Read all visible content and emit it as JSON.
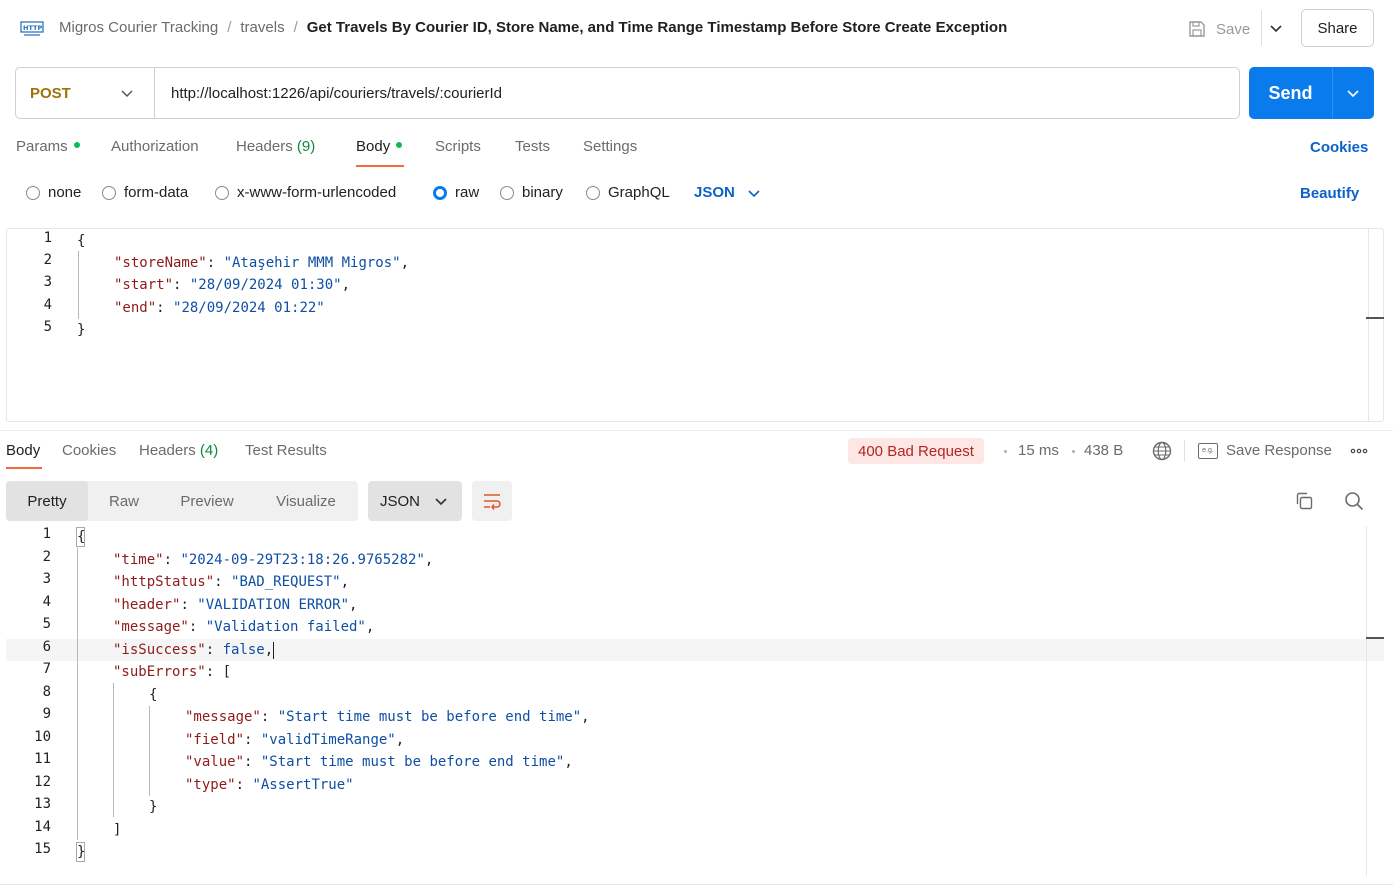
{
  "breadcrumb": {
    "collection": "Migros Courier Tracking",
    "folder": "travels",
    "request": "Get Travels By Courier ID, Store Name, and Time Range Timestamp Before Store Create Exception",
    "separator": "/"
  },
  "toolbar": {
    "save_label": "Save",
    "share_label": "Share"
  },
  "request": {
    "method": "POST",
    "url": "http://localhost:1226/api/couriers/travels/:courierId",
    "send_label": "Send"
  },
  "request_tabs": {
    "params": "Params",
    "authorization": "Authorization",
    "headers": "Headers",
    "headers_count": "(9)",
    "body": "Body",
    "scripts": "Scripts",
    "tests": "Tests",
    "settings": "Settings",
    "cookies": "Cookies"
  },
  "body_modes": {
    "none": "none",
    "form_data": "form-data",
    "urlencoded": "x-www-form-urlencoded",
    "raw": "raw",
    "binary": "binary",
    "graphql": "GraphQL",
    "selected": "raw",
    "language": "JSON",
    "beautify": "Beautify"
  },
  "request_body": {
    "line_numbers": [
      "1",
      "2",
      "3",
      "4",
      "5"
    ],
    "open_brace": "{",
    "close_brace": "}",
    "fields": [
      {
        "key": "\"storeName\"",
        "value": "\"Ataşehir MMM Migros\"",
        "comma": ","
      },
      {
        "key": "\"start\"",
        "value": "\"28/09/2024 01:30\"",
        "comma": ","
      },
      {
        "key": "\"end\"",
        "value": "\"28/09/2024 01:22\"",
        "comma": ""
      }
    ]
  },
  "response_tabs": {
    "body": "Body",
    "cookies": "Cookies",
    "headers": "Headers",
    "headers_count": "(4)",
    "test_results": "Test Results"
  },
  "response_meta": {
    "status": "400 Bad Request",
    "time": "15 ms",
    "size": "438 B",
    "save_response": "Save Response",
    "save_icon_text": "e.g."
  },
  "view_modes": {
    "pretty": "Pretty",
    "raw": "Raw",
    "preview": "Preview",
    "visualize": "Visualize",
    "language": "JSON"
  },
  "response_body": {
    "line_numbers": [
      "1",
      "2",
      "3",
      "4",
      "5",
      "6",
      "7",
      "8",
      "9",
      "10",
      "11",
      "12",
      "13",
      "14",
      "15"
    ],
    "open_brace": "{",
    "close_brace": "}",
    "time_key": "\"time\"",
    "time_val": "\"2024-09-29T23:18:26.9765282\"",
    "status_key": "\"httpStatus\"",
    "status_val": "\"BAD_REQUEST\"",
    "header_key": "\"header\"",
    "header_val": "\"VALIDATION ERROR\"",
    "message_key": "\"message\"",
    "message_val": "\"Validation failed\"",
    "success_key": "\"isSuccess\"",
    "success_val": "false",
    "suberrors_key": "\"subErrors\"",
    "open_bracket": "[",
    "close_bracket": "]",
    "sub_message_key": "\"message\"",
    "sub_message_val": "\"Start time must be before end time\"",
    "sub_field_key": "\"field\"",
    "sub_field_val": "\"validTimeRange\"",
    "sub_value_key": "\"value\"",
    "sub_value_val": "\"Start time must be before end time\"",
    "sub_type_key": "\"type\"",
    "sub_type_val": "\"AssertTrue\""
  },
  "colors": {
    "accent": "#097bed",
    "method": "#a0720a",
    "tab_underline": "#f26b3a",
    "status_bg": "#fde6e4",
    "status_text": "#b3261e",
    "json_key": "#8e1b1b",
    "json_string": "#0f4fa3",
    "success_dot": "#0cbb52"
  }
}
